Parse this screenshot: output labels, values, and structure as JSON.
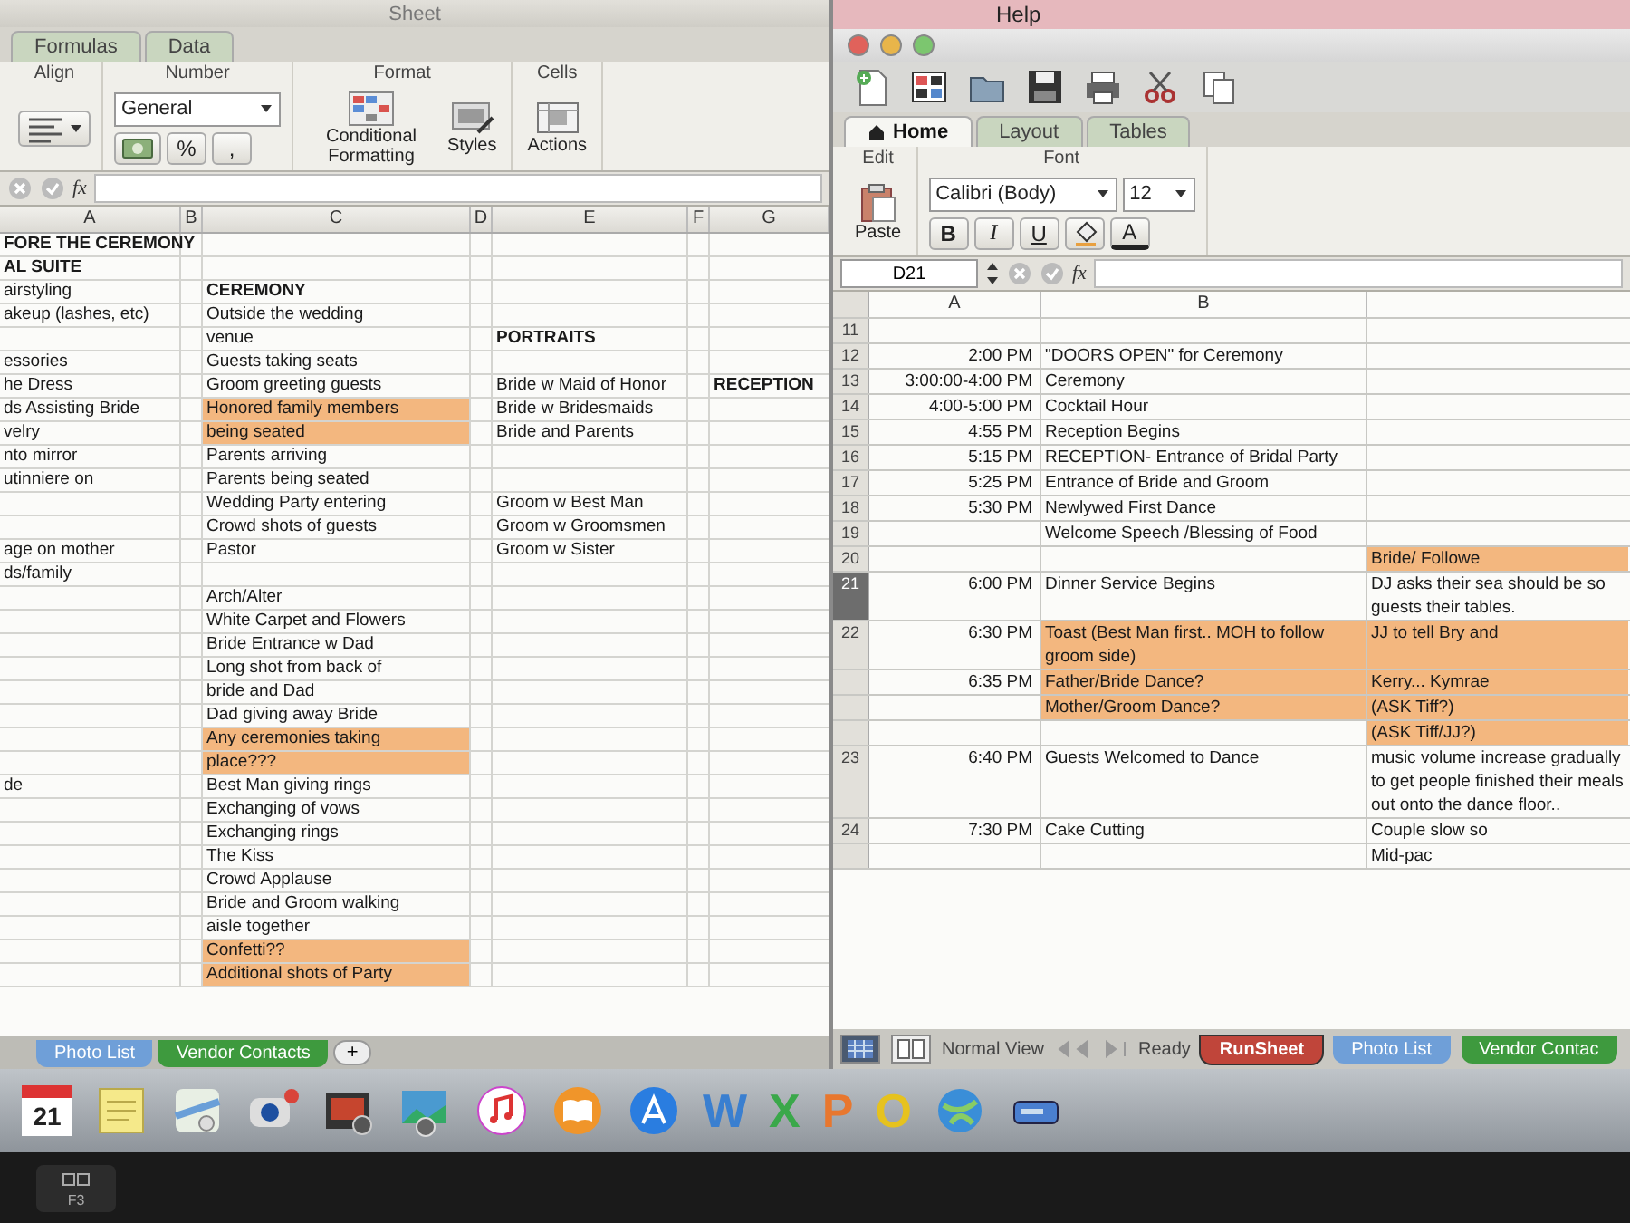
{
  "left_window": {
    "title": "Sheet",
    "ribbon_tabs": [
      {
        "label": "Formulas",
        "selected": false
      },
      {
        "label": "Data",
        "selected": false
      }
    ],
    "groups": {
      "align": "Align",
      "number": "Number",
      "format": "Format",
      "cells": "Cells"
    },
    "number_format": "General",
    "number_buttons": [
      "%",
      ","
    ],
    "format_buttons": [
      {
        "kind": "conditional",
        "label": "Conditional Formatting"
      },
      {
        "kind": "styles",
        "label": "Styles"
      }
    ],
    "cells_buttons": [
      {
        "kind": "actions",
        "label": "Actions"
      }
    ],
    "fx": "fx",
    "columns": [
      "A",
      "B",
      "C",
      "D",
      "E",
      "F",
      "G"
    ],
    "rows": [
      {
        "col_a": {
          "text": "FORE THE CEREMONY",
          "bold": true,
          "highlighted": false
        }
      },
      {
        "col_a": {
          "text": "AL SUITE",
          "bold": true,
          "highlighted": false
        }
      },
      {
        "col_a": {
          "text": "airstyling",
          "bold": false,
          "highlighted": false
        },
        "col_c": {
          "text": "CEREMONY",
          "bold": true,
          "highlighted": false
        }
      },
      {
        "col_a": {
          "text": "akeup (lashes, etc)",
          "bold": false,
          "highlighted": false
        },
        "col_c": {
          "text": "Outside the wedding",
          "bold": false,
          "highlighted": false
        }
      },
      {
        "col_c": {
          "text": "venue",
          "bold": false,
          "highlighted": false
        },
        "col_e": {
          "text": "PORTRAITS",
          "bold": true,
          "highlighted": false
        }
      },
      {
        "col_a": {
          "text": "essories",
          "bold": false,
          "highlighted": false
        },
        "col_c": {
          "text": "Guests taking seats",
          "bold": false,
          "highlighted": false
        }
      },
      {
        "col_a": {
          "text": "he Dress",
          "bold": false,
          "highlighted": false
        },
        "col_c": {
          "text": "Groom greeting guests",
          "bold": false,
          "highlighted": false
        },
        "col_e": {
          "text": "Bride w Maid of Honor",
          "bold": false,
          "highlighted": false
        },
        "col_g": {
          "text": "RECEPTION",
          "bold": true,
          "highlighted": false
        }
      },
      {
        "col_a": {
          "text": "ds Assisting Bride",
          "bold": false,
          "highlighted": false
        },
        "col_c": {
          "text": "Honored family members",
          "bold": false,
          "highlighted": true
        },
        "col_e": {
          "text": "Bride w Bridesmaids",
          "bold": false,
          "highlighted": false
        }
      },
      {
        "col_a": {
          "text": "velry",
          "bold": false,
          "highlighted": false
        },
        "col_c": {
          "text": "being seated",
          "bold": false,
          "highlighted": true
        },
        "col_e": {
          "text": "Bride and Parents",
          "bold": false,
          "highlighted": false
        }
      },
      {
        "col_a": {
          "text": "nto mirror",
          "bold": false,
          "highlighted": false
        },
        "col_c": {
          "text": "Parents arriving",
          "bold": false,
          "highlighted": false
        }
      },
      {
        "col_a": {
          "text": "utinniere on",
          "bold": false,
          "highlighted": false
        },
        "col_c": {
          "text": "Parents being seated",
          "bold": false,
          "highlighted": false
        }
      },
      {
        "col_c": {
          "text": "Wedding Party entering",
          "bold": false,
          "highlighted": false
        },
        "col_e": {
          "text": "Groom w Best Man",
          "bold": false,
          "highlighted": false
        }
      },
      {
        "col_c": {
          "text": "Crowd shots of guests",
          "bold": false,
          "highlighted": false
        },
        "col_e": {
          "text": "Groom w Groomsmen",
          "bold": false,
          "highlighted": false
        }
      },
      {
        "col_a": {
          "text": "age on mother",
          "bold": false,
          "highlighted": false
        },
        "col_c": {
          "text": "Pastor",
          "bold": false,
          "highlighted": false
        },
        "col_e": {
          "text": "Groom w Sister",
          "bold": false,
          "highlighted": false
        }
      },
      {
        "col_a": {
          "text": "ds/family",
          "bold": false,
          "highlighted": false
        }
      },
      {
        "col_c": {
          "text": "Arch/Alter",
          "bold": false,
          "highlighted": false
        }
      },
      {
        "col_c": {
          "text": "White Carpet and Flowers",
          "bold": false,
          "highlighted": false
        }
      },
      {
        "col_c": {
          "text": "Bride Entrance w Dad",
          "bold": false,
          "highlighted": false
        }
      },
      {
        "col_c": {
          "text": "Long shot from back of",
          "bold": false,
          "highlighted": false
        }
      },
      {
        "col_c": {
          "text": "bride and Dad",
          "bold": false,
          "highlighted": false
        }
      },
      {
        "col_c": {
          "text": "Dad giving away Bride",
          "bold": false,
          "highlighted": false
        }
      },
      {
        "col_c": {
          "text": "Any ceremonies taking",
          "bold": false,
          "highlighted": true
        }
      },
      {
        "col_c": {
          "text": "place???",
          "bold": false,
          "highlighted": true
        }
      },
      {
        "col_a": {
          "text": "de",
          "bold": false,
          "highlighted": false
        },
        "col_c": {
          "text": "Best Man giving rings",
          "bold": false,
          "highlighted": false
        }
      },
      {
        "col_c": {
          "text": "Exchanging of vows",
          "bold": false,
          "highlighted": false
        }
      },
      {
        "col_c": {
          "text": "Exchanging rings",
          "bold": false,
          "highlighted": false
        }
      },
      {
        "col_c": {
          "text": "The Kiss",
          "bold": false,
          "highlighted": false
        }
      },
      {
        "col_c": {
          "text": "Crowd Applause",
          "bold": false,
          "highlighted": false
        }
      },
      {
        "col_c": {
          "text": "Bride and Groom walking",
          "bold": false,
          "highlighted": false
        }
      },
      {
        "col_c": {
          "text": "aisle together",
          "bold": false,
          "highlighted": false
        }
      },
      {
        "col_c": {
          "text": "Confetti??",
          "bold": false,
          "highlighted": true
        }
      },
      {
        "col_c": {
          "text": "Additional shots of Party",
          "bold": false,
          "highlighted": true
        }
      }
    ],
    "sheet_tabs": [
      {
        "label": "Photo List",
        "color": "#6f9fd8",
        "selected": false
      },
      {
        "label": "Vendor Contacts",
        "color": "#3e9a3e",
        "selected": false
      }
    ],
    "add_sheet": "+"
  },
  "right_window": {
    "menu_title": "Help",
    "ribbon_tabs": [
      {
        "label": "Home",
        "selected": true
      },
      {
        "label": "Layout",
        "selected": false
      },
      {
        "label": "Tables",
        "selected": false
      }
    ],
    "groups": {
      "edit": "Edit",
      "font": "Font"
    },
    "paste_label": "Paste",
    "font_name": "Calibri (Body)",
    "font_size": "12",
    "style_buttons": [
      "B",
      "I",
      "U"
    ],
    "font_color_label": "A",
    "name_box": "D21",
    "fx": "fx",
    "columns": [
      "A",
      "B"
    ],
    "rows": [
      {
        "number": "11",
        "selected": false,
        "event_highlighted": false,
        "note_highlighted": false
      },
      {
        "number": "12",
        "time": "2:00 PM",
        "event": "\"DOORS OPEN\" for Ceremony",
        "selected": false,
        "event_highlighted": false,
        "note_highlighted": false
      },
      {
        "number": "13",
        "time": "3:00:00-4:00 PM",
        "event": "Ceremony",
        "selected": false,
        "event_highlighted": false,
        "note_highlighted": false
      },
      {
        "number": "14",
        "time": "4:00-5:00 PM",
        "event": "Cocktail Hour",
        "selected": false,
        "event_highlighted": false,
        "note_highlighted": false
      },
      {
        "number": "15",
        "time": "4:55 PM",
        "event": "Reception Begins",
        "selected": false,
        "event_highlighted": false,
        "note_highlighted": false
      },
      {
        "number": "16",
        "time": "5:15 PM",
        "event": "RECEPTION- Entrance of Bridal Party",
        "selected": false,
        "event_highlighted": false,
        "note_highlighted": false
      },
      {
        "number": "17",
        "time": "5:25 PM",
        "event": "Entrance of Bride and Groom",
        "selected": false,
        "event_highlighted": false,
        "note_highlighted": false
      },
      {
        "number": "18",
        "time": "5:30 PM",
        "event": "Newlywed First Dance",
        "selected": false,
        "event_highlighted": false,
        "note_highlighted": false
      },
      {
        "number": "19",
        "event": "Welcome Speech /Blessing of Food",
        "selected": false,
        "event_highlighted": false,
        "note_highlighted": false
      },
      {
        "number": "20",
        "note": "Bride/ Followe",
        "selected": false,
        "event_highlighted": false,
        "note_highlighted": true
      },
      {
        "number": "21",
        "time": "6:00 PM",
        "event": "Dinner Service Begins",
        "note": "DJ asks their sea should be so guests their tables.",
        "selected": true,
        "event_highlighted": false,
        "note_highlighted": false
      },
      {
        "number": "22",
        "time": "6:30 PM",
        "event": "Toast (Best Man first.. MOH to follow groom side)",
        "note": "JJ to tell Bry and",
        "selected": false,
        "event_highlighted": true,
        "note_highlighted": true
      },
      {
        "time": "6:35 PM",
        "event": "Father/Bride Dance?",
        "note": "Kerry... Kymrae",
        "selected": false,
        "event_highlighted": true,
        "note_highlighted": true
      },
      {
        "event": "Mother/Groom Dance?",
        "note": "(ASK Tiff?)",
        "selected": false,
        "event_highlighted": true,
        "note_highlighted": true
      },
      {
        "note": "(ASK Tiff/JJ?)",
        "selected": false,
        "event_highlighted": false,
        "note_highlighted": true
      },
      {
        "number": "23",
        "time": "6:40 PM",
        "event": "Guests Welcomed to Dance",
        "note": "music volume increase gradually to get people finished their meals out onto the dance floor..",
        "selected": false,
        "event_highlighted": false,
        "note_highlighted": false
      },
      {
        "number": "24",
        "time": "7:30 PM",
        "event": "Cake Cutting",
        "note": "Couple slow so",
        "selected": false,
        "event_highlighted": false,
        "note_highlighted": false
      },
      {
        "note": "Mid-pac",
        "selected": false,
        "event_highlighted": false,
        "note_highlighted": false
      }
    ],
    "view_label": "Normal View",
    "status_text": "Ready",
    "sheet_tabs": [
      {
        "label": "RunSheet",
        "color": "#c0453a",
        "selected": true
      },
      {
        "label": "Photo List",
        "color": "#6f9fd8",
        "selected": false
      },
      {
        "label": "Vendor Contac",
        "color": "#3e9a3e",
        "selected": false
      }
    ]
  },
  "dock": {
    "items": [
      {
        "kind": "calendar",
        "label": "21"
      },
      {
        "kind": "notes"
      },
      {
        "kind": "maps"
      },
      {
        "kind": "camera"
      },
      {
        "kind": "filmstrip"
      },
      {
        "kind": "photo"
      },
      {
        "kind": "music"
      },
      {
        "kind": "book"
      },
      {
        "kind": "store"
      },
      {
        "kind": "letter",
        "label": "W",
        "color": "#3a7fd0"
      },
      {
        "kind": "letter",
        "label": "X",
        "color": "#3aa84a"
      },
      {
        "kind": "letter",
        "label": "P",
        "color": "#e8772e"
      },
      {
        "kind": "letter",
        "label": "O",
        "color": "#e6c21e"
      },
      {
        "kind": "globe"
      },
      {
        "kind": "drive"
      }
    ]
  },
  "keyboard": {
    "key_label": "F3"
  }
}
